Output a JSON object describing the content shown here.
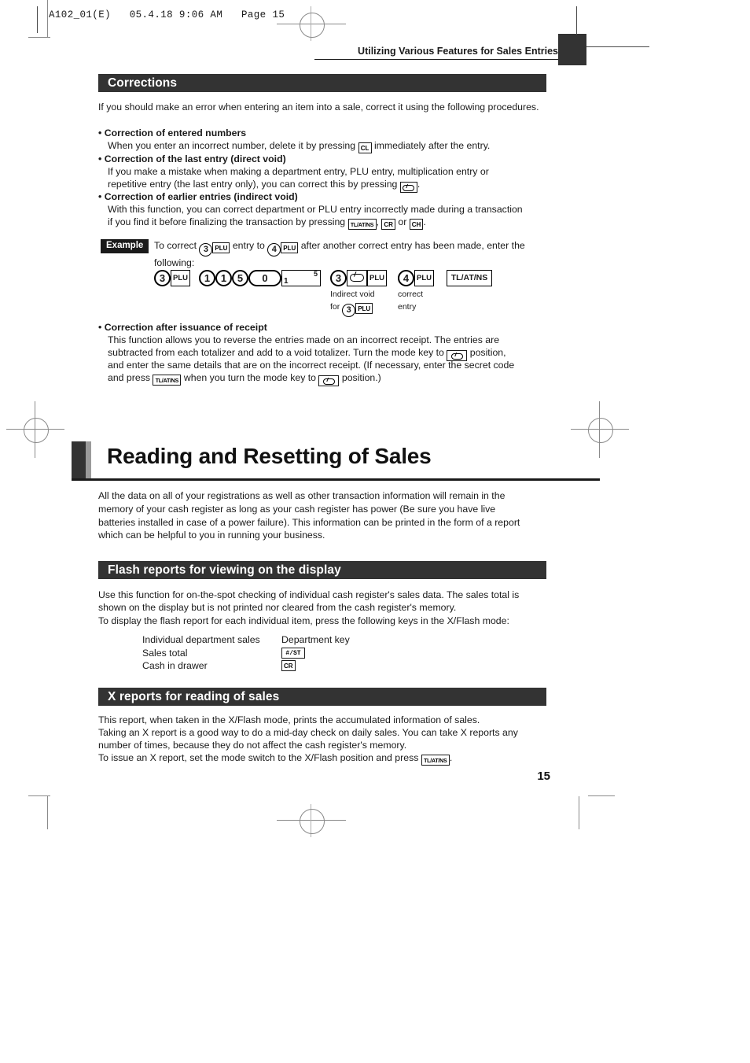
{
  "prepress": {
    "slug": "A102_01(E)   05.4.18 9:06 AM   Page 15"
  },
  "running_head": "Utilizing Various Features for Sales Entries",
  "page_number": "15",
  "sections": {
    "corrections": {
      "banner": "Corrections",
      "intro": "If you should make an error when entering an item into a sale, correct it using the following procedures.",
      "bullets": [
        {
          "title": "Correction of entered numbers",
          "body_before": "When you enter an incorrect number, delete it by pressing",
          "key": "CL",
          "body_after": "immediately after the entry."
        },
        {
          "title": "Correction of the last entry (direct void)",
          "body_line1": "If you make a mistake when making a department entry, PLU entry, multiplication entry or",
          "body_line2_before": "repetitive entry (the last entry only), you can correct this by pressing",
          "body_line2_after": "."
        },
        {
          "title": "Correction of earlier entries (indirect void)",
          "body_line1": "With this function, you can correct department or PLU entry incorrectly made during a transaction",
          "body_line2_before": "if you find it before finalizing the transaction by pressing",
          "key1": "TL/AT/NS",
          "sep1": ",",
          "key2": "CR",
          "sep2": "or",
          "key3": "CH",
          "body_line2_after": "."
        },
        {
          "title": "Correction after issuance of receipt",
          "line1": "This function allows you to reverse the entries made on an incorrect receipt.  The entries are",
          "line2_before": "subtracted from each totalizer and add to a void totalizer.  Turn the mode key to",
          "line2_after": "position,",
          "line3": "and enter the same details that are on the incorrect receipt.  (If necessary, enter the secret code",
          "line4_before": "and press",
          "line4_key": "TL/AT/NS",
          "line4_mid": "when you turn the mode key to",
          "line4_after": "position.)"
        }
      ],
      "example": {
        "tag": "Example",
        "text_part1": "To correct",
        "num1": "3",
        "key1": "PLU",
        "text_part2": "entry to",
        "num2": "4",
        "key2": "PLU",
        "text_part3": "after another correct entry has been made, enter the",
        "text_part4": "following:",
        "sequence": [
          {
            "type": "round-plu",
            "num": "3",
            "key": "PLU",
            "caption": ""
          },
          {
            "type": "digits",
            "digits": [
              "1",
              "1",
              "5"
            ],
            "zero": "0",
            "mult_left": "1",
            "mult_right": "5",
            "caption": ""
          },
          {
            "type": "round-void-plu",
            "num": "3",
            "key": "PLU",
            "caption_line1": "Indirect void",
            "caption_line2_before": "for",
            "caption_line2_num": "3",
            "caption_line2_key": "PLU"
          },
          {
            "type": "round-plu",
            "num": "4",
            "key": "PLU",
            "caption_line1": "correct",
            "caption_line2": "entry"
          },
          {
            "type": "wide-key",
            "key": "TL/AT/NS",
            "caption": ""
          }
        ]
      }
    },
    "chapter": {
      "title": "Reading and Resetting of Sales",
      "intro": "All the data on all of your registrations as well as other transaction information will remain in the memory of your cash register as long as your cash register has power (Be sure you have live batteries installed in case of a power failure).  This information can be printed in the form of a report which can be helpful to you in running your business."
    },
    "flash_reports": {
      "banner": "Flash reports for viewing on the display",
      "line1": "Use this function for on-the-spot checking of individual cash register's sales data.  The sales total is",
      "line2": "shown on the display but is not printed nor cleared from the cash register's memory.",
      "line3": "To display the flash report for each individual item, press the following keys in the X/Flash mode:",
      "rows": [
        {
          "name": "Individual department sales",
          "value": "Department key",
          "value_is_key": false
        },
        {
          "name": "Sales total",
          "value": "#/ST",
          "value_is_key": true
        },
        {
          "name": "Cash in drawer",
          "value": "CR",
          "value_is_key": true
        }
      ]
    },
    "x_reports": {
      "banner": "X reports for reading of sales",
      "line1": "This report, when taken in the X/Flash mode, prints the accumulated information of sales.",
      "line2": "Taking an X report is a good way to do a mid-day check on daily sales.  You can take X reports any",
      "line3": "number of times, because they do not affect the cash register's memory.",
      "line4_before": "To issue an X report, set the mode switch to the X/Flash position and press",
      "line4_key": "TL/AT/NS",
      "line4_after": "."
    }
  },
  "colors": {
    "banner_bg": "#333333",
    "banner_text": "#ffffff",
    "body_text": "#1a1a1a",
    "crop_mark": "#8a8a8a"
  }
}
